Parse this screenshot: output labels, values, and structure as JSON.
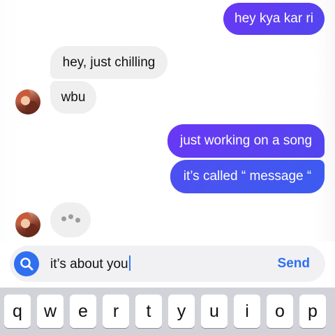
{
  "messages": {
    "out_1": "hey kya kar ri",
    "in_1": "hey, just chilling",
    "in_2": "wbu",
    "out_2": "just working on a song",
    "out_3": "it’s called “ message “"
  },
  "typing_indicator": {
    "visible": true
  },
  "avatar": {
    "icon": "contact-avatar-icon"
  },
  "composer": {
    "text": "it’s about you",
    "send_label": "Send",
    "search_icon": "search-icon"
  },
  "keyboard": {
    "row1": [
      "q",
      "w",
      "e",
      "r",
      "t",
      "y",
      "u",
      "i",
      "o",
      "p"
    ]
  },
  "colors": {
    "outgoing_bubble": "#5b3ff3",
    "incoming_bubble": "#efefef",
    "accent": "#2f6ff0",
    "keyboard_bg": "#d1d3d9"
  }
}
